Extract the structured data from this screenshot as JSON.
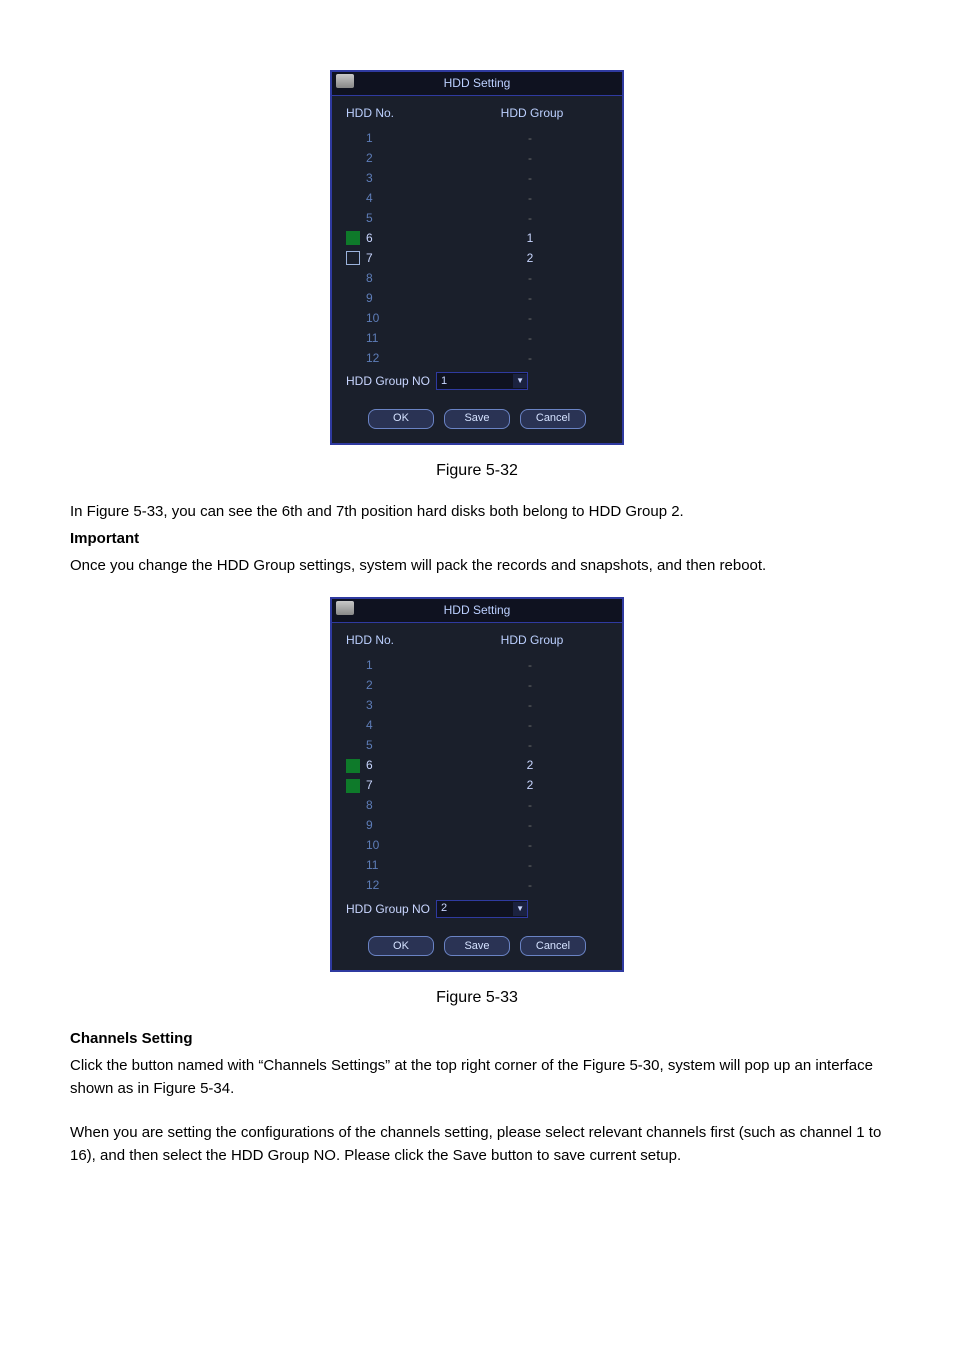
{
  "dialog1": {
    "title": "HDD Setting",
    "hdr_no": "HDD No.",
    "hdr_grp": "HDD Group",
    "rows": [
      {
        "no": "1",
        "grp": "-",
        "chk": "none"
      },
      {
        "no": "2",
        "grp": "-",
        "chk": "none"
      },
      {
        "no": "3",
        "grp": "-",
        "chk": "none"
      },
      {
        "no": "4",
        "grp": "-",
        "chk": "none"
      },
      {
        "no": "5",
        "grp": "-",
        "chk": "none"
      },
      {
        "no": "6",
        "grp": "1",
        "chk": "checked"
      },
      {
        "no": "7",
        "grp": "2",
        "chk": "unchecked"
      },
      {
        "no": "8",
        "grp": "-",
        "chk": "none"
      },
      {
        "no": "9",
        "grp": "-",
        "chk": "none"
      },
      {
        "no": "10",
        "grp": "-",
        "chk": "none"
      },
      {
        "no": "11",
        "grp": "-",
        "chk": "none"
      },
      {
        "no": "12",
        "grp": "-",
        "chk": "none"
      }
    ],
    "group_label": "HDD Group NO",
    "group_value": "1",
    "ok": "OK",
    "save": "Save",
    "cancel": "Cancel"
  },
  "figcap1": "Figure 5-32",
  "para1": "In Figure 5-33, you can see the 6th and 7th position hard disks both belong to HDD Group 2.",
  "important": "Important",
  "para2": "Once you change the HDD Group settings, system will pack the records and snapshots, and then reboot.",
  "dialog2": {
    "title": "HDD Setting",
    "hdr_no": "HDD No.",
    "hdr_grp": "HDD Group",
    "rows": [
      {
        "no": "1",
        "grp": "-",
        "chk": "none"
      },
      {
        "no": "2",
        "grp": "-",
        "chk": "none"
      },
      {
        "no": "3",
        "grp": "-",
        "chk": "none"
      },
      {
        "no": "4",
        "grp": "-",
        "chk": "none"
      },
      {
        "no": "5",
        "grp": "-",
        "chk": "none"
      },
      {
        "no": "6",
        "grp": "2",
        "chk": "checked"
      },
      {
        "no": "7",
        "grp": "2",
        "chk": "checked"
      },
      {
        "no": "8",
        "grp": "-",
        "chk": "none"
      },
      {
        "no": "9",
        "grp": "-",
        "chk": "none"
      },
      {
        "no": "10",
        "grp": "-",
        "chk": "none"
      },
      {
        "no": "11",
        "grp": "-",
        "chk": "none"
      },
      {
        "no": "12",
        "grp": "-",
        "chk": "none"
      }
    ],
    "group_label": "HDD Group NO",
    "group_value": "2",
    "ok": "OK",
    "save": "Save",
    "cancel": "Cancel"
  },
  "figcap2": "Figure 5-33",
  "channels_heading": "Channels Setting",
  "para3": "Click the button named with “Channels Settings” at the top right corner of the Figure 5-30, system will pop up an interface shown as in Figure 5-34.",
  "para4": "When you are setting the configurations of the channels setting, please select relevant channels first (such as channel 1 to 16), and then select the HDD Group NO. Please click the Save button to save current setup."
}
